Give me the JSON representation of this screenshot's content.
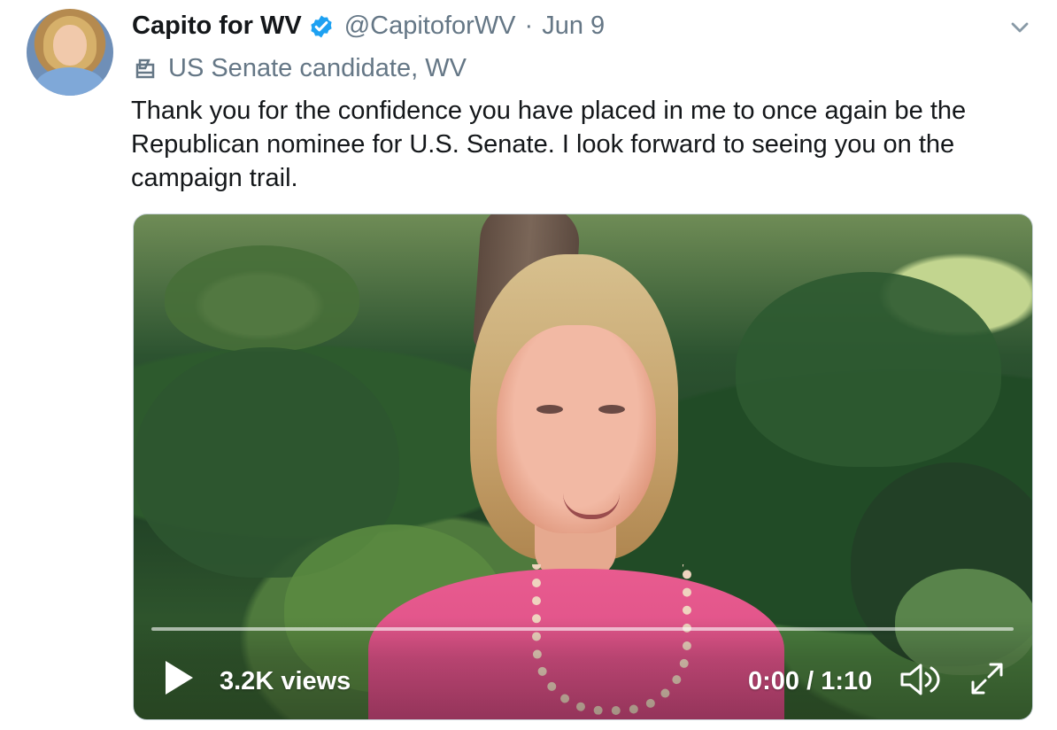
{
  "tweet": {
    "display_name": "Capito for WV",
    "handle": "@CapitoforWV",
    "separator": "·",
    "timestamp": "Jun 9",
    "label": "US Senate candidate, WV",
    "text": "Thank you for the confidence you have placed in me to once again be the Republican nominee for U.S. Senate. I look forward to seeing you on the campaign trail."
  },
  "video": {
    "views": "3.2K views",
    "time": "0:00 / 1:10",
    "progress_fraction": 0
  },
  "icons": {
    "verified": "verified-badge-icon",
    "menu": "chevron-down-icon",
    "label": "ballot-box-icon",
    "play": "play-icon",
    "volume": "volume-icon",
    "fullscreen": "expand-icon"
  },
  "colors": {
    "text": "#14171a",
    "secondary": "#657786",
    "verified": "#1da1f2",
    "border": "#ccd6dd",
    "control_white": "#ffffff"
  }
}
